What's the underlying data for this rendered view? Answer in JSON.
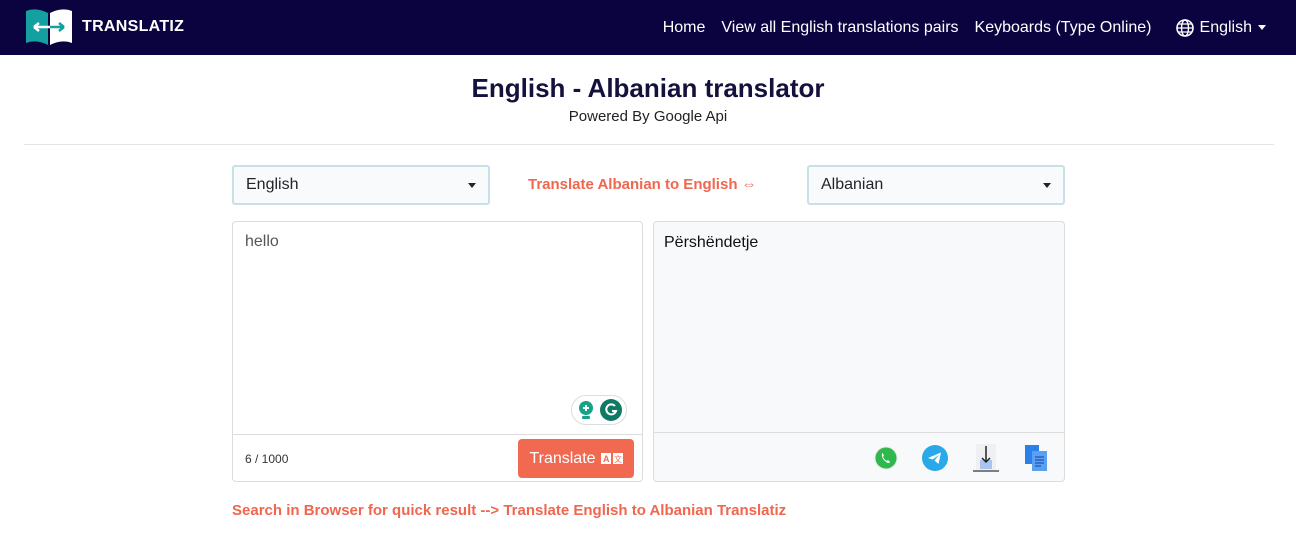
{
  "header": {
    "brand": "TRANSLATIZ",
    "nav": [
      "Home",
      "View all English translations pairs",
      "Keyboards (Type Online)"
    ],
    "language": "English"
  },
  "title": "English - Albanian translator",
  "subtitle": "Powered By Google Api",
  "source_language": "English",
  "target_language": "Albanian",
  "swap_link": "Translate Albanian to English ⇔",
  "input_text": "hello",
  "char_count": "6 / 1000",
  "translate_label": "Translate",
  "output_text": "Përshëndetje",
  "bottom_link": "Search in Browser for quick result --> Translate English to Albanian Translatiz",
  "colors": {
    "navbar": "#0b0340",
    "accent": "#f26952"
  }
}
